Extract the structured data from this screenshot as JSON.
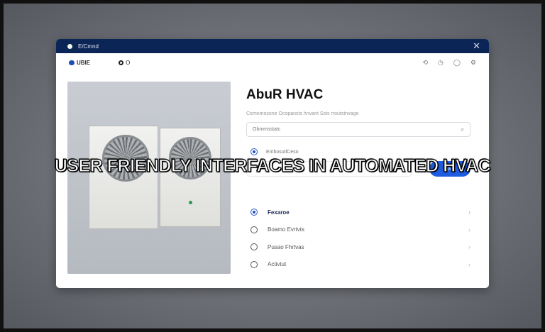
{
  "window": {
    "title": "E/Cmnd",
    "close_icon": "close-icon"
  },
  "toolbar": {
    "logo_text": "UBIE",
    "item2": "O",
    "icons": [
      "history-icon",
      "clock-icon",
      "shield-icon",
      "settings-icon"
    ]
  },
  "main": {
    "title": "AbuR HVAC",
    "subtitle": "Comnmosone Ocopansts hnvant Ssts rroutstnvage",
    "search_placeholder": "Obmmsstatc",
    "info_label": "EmbosutlCeso",
    "button_label": "Uavd"
  },
  "nav": [
    {
      "label": "Fexaroe",
      "active": true
    },
    {
      "label": "Boamo Evrtvts"
    },
    {
      "label": "Pusao Fhrtvas"
    },
    {
      "label": "Activtut"
    }
  ],
  "caption": "USER FRIENDLY INTERFACES IN AUTOMATED HVAC",
  "colors": {
    "titlebar": "#0c2557",
    "accent": "#1d5be0"
  }
}
